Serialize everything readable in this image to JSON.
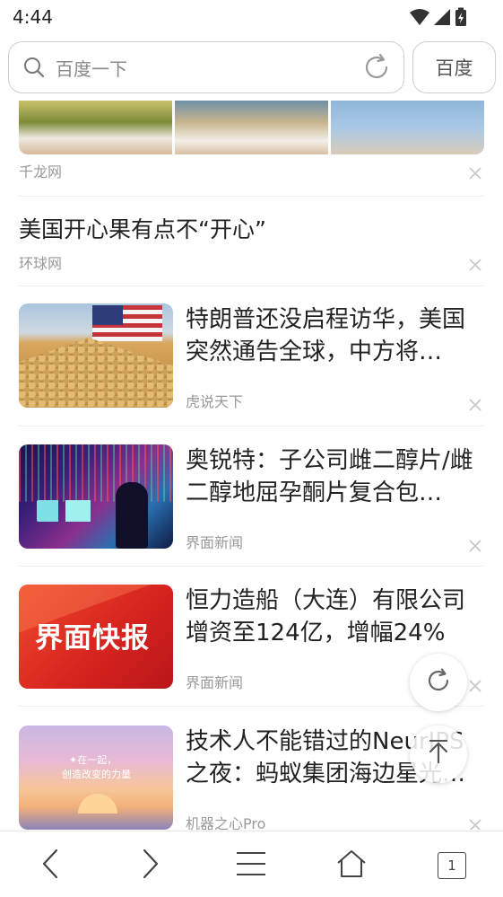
{
  "status_bar": {
    "time": "4:44",
    "icons": [
      "wifi-icon",
      "signal-icon",
      "battery-charging-icon"
    ]
  },
  "search": {
    "placeholder": "百度一下",
    "submit_label": "百度"
  },
  "feed": {
    "top_item": {
      "source": "千龙网"
    },
    "text_item": {
      "title": "美国开心果有点不“开心”",
      "source": "环球网"
    },
    "items": [
      {
        "title": "特朗普还没启程访华，美国突然通告全球，中方将…",
        "source": "虎说天下"
      },
      {
        "title": "奥锐特：子公司雌二醇片/雌二醇地屈孕酮片复合包…",
        "source": "界面新闻"
      },
      {
        "title": "恒力造船（大连）有限公司增资至124亿，增幅24%",
        "source": "界面新闻",
        "thumb_text": "界面快报"
      },
      {
        "title": "技术人不能错过的NeurIPS之夜：蚂蚁集团海边星光…",
        "source": "机器之心Pro",
        "thumb_text_1": "✦在一起，",
        "thumb_text_2": "创造改变的力量"
      }
    ]
  },
  "bottom_nav": {
    "tab_count": "1",
    "icons": [
      "back-icon",
      "forward-icon",
      "menu-icon",
      "home-icon",
      "tabs-icon"
    ]
  },
  "colors": {
    "text_primary": "#222222",
    "text_secondary": "#999999",
    "border": "#cfcfcf"
  }
}
